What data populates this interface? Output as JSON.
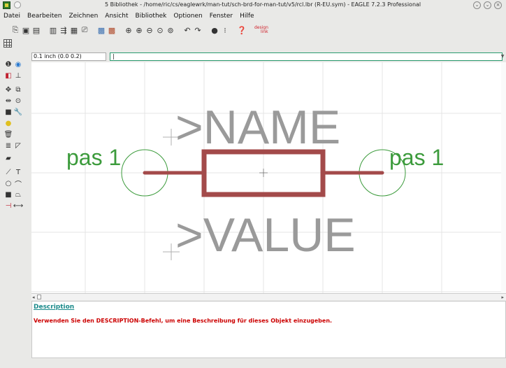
{
  "window": {
    "title": "5 Bibliothek - /home/ric/cs/eaglewrk/man-tut/sch-brd-for-man-tut/v5/rcl.lbr (R-EU.sym) - EAGLE 7.2.3 Professional"
  },
  "menu": {
    "items": [
      "Datei",
      "Bearbeiten",
      "Zeichnen",
      "Ansicht",
      "Bibliothek",
      "Optionen",
      "Fenster",
      "Hilfe"
    ]
  },
  "toolbar": {
    "icons": [
      "open-icon",
      "save-icon",
      "print-icon",
      "cam-icon",
      "board-icon",
      "ulp-icon",
      "script-icon",
      "schematic-icon",
      "brd-switch-icon",
      "zoom-fit-icon",
      "zoom-in-icon",
      "zoom-out-icon",
      "zoom-redraw-icon",
      "zoom-select-icon",
      "undo-icon",
      "redo-icon",
      "stop-icon",
      "go-icon",
      "help-icon",
      "designlink-icon"
    ],
    "designlink_label_top": "design",
    "designlink_label_bottom": "link"
  },
  "command_line": {
    "grid_info": "0.1 inch (0.0 0.2)",
    "value": "|"
  },
  "canvas": {
    "name_label": ">NAME",
    "value_label": ">VALUE",
    "pin_left": "pas 1",
    "pin_right": "pas 1",
    "colors": {
      "name_text": "#9a9a9a",
      "pin_text": "#3c9b3c",
      "symbol": "#a34a4a",
      "pin_circle": "#3c9b3c",
      "grid": "#e4e4e4"
    }
  },
  "description": {
    "title": "Description",
    "text": "Verwenden Sie den DESCRIPTION-Befehl, um eine Beschreibung für dieses Objekt einzugeben."
  }
}
